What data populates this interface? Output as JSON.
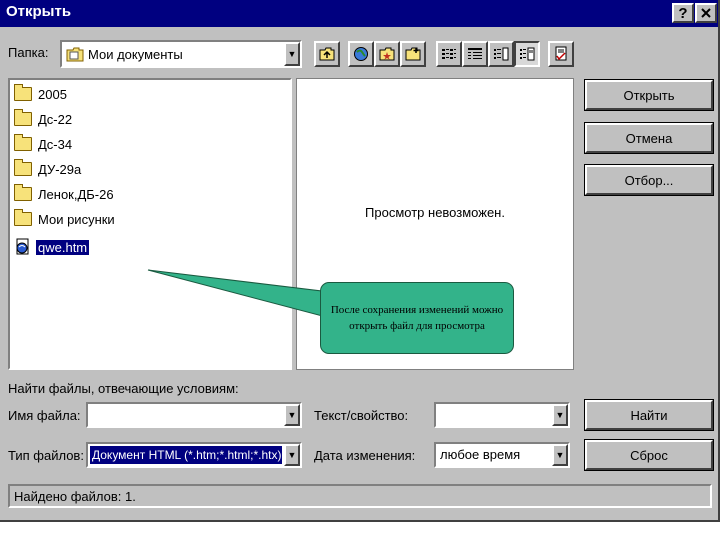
{
  "window": {
    "title": "Открыть",
    "help_label": "?",
    "close_label": "✕"
  },
  "toolbar": {
    "folder_label": "Папка:",
    "folder_value": "Мои документы"
  },
  "files": [
    {
      "name": "2005",
      "type": "folder"
    },
    {
      "name": "Дс-22",
      "type": "folder"
    },
    {
      "name": "Дс-34",
      "type": "folder"
    },
    {
      "name": "ДУ-29а",
      "type": "folder"
    },
    {
      "name": "Ленок,ДБ-26",
      "type": "folder"
    },
    {
      "name": "Мои рисунки",
      "type": "folder"
    },
    {
      "name": "qwe.htm",
      "type": "html",
      "selected": true
    }
  ],
  "preview": {
    "message": "Просмотр невозможен."
  },
  "buttons": {
    "open": "Открыть",
    "cancel": "Отмена",
    "filter": "Отбор...",
    "find": "Найти",
    "reset": "Сброс"
  },
  "search": {
    "heading": "Найти файлы, отвечающие условиям:",
    "filename_label": "Имя файла:",
    "filename_value": "",
    "filetype_label": "Тип файлов:",
    "filetype_value": "Документ HTML (*.htm;*.html;*.htx)",
    "text_label": "Текст/свойство:",
    "text_value": "",
    "date_label": "Дата изменения:",
    "date_value": "любое время"
  },
  "status": {
    "text": "Найдено файлов: 1."
  },
  "callout": {
    "text": "После сохранения изменений можно открыть файл для просмотра"
  },
  "colors": {
    "title_bar": "#000080",
    "dialog": "#c0c0c0",
    "callout": "#33b38a"
  }
}
